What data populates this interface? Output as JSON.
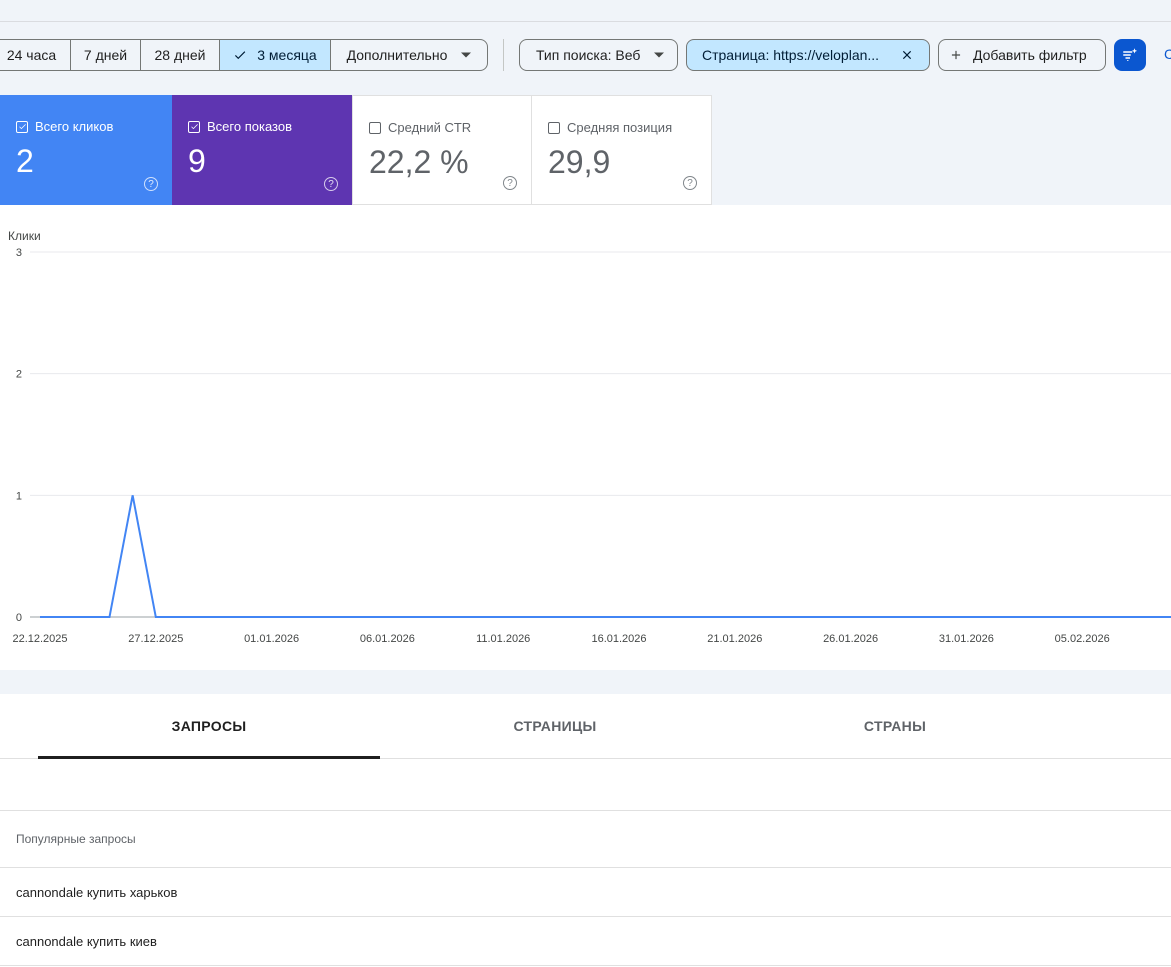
{
  "date_filters": [
    "24 часа",
    "7 дней",
    "28 дней",
    "3 месяца",
    "Дополнительно"
  ],
  "active_date_filter": "3 месяца",
  "search_type_label": "Тип поиска: Веб",
  "page_filter_label": "Страница: https://veloplan...",
  "add_filter_label": "Добавить фильтр",
  "metrics": {
    "clicks": {
      "label": "Всего кликов",
      "value": "2",
      "checked": true
    },
    "impressions": {
      "label": "Всего показов",
      "value": "9",
      "checked": true
    },
    "ctr": {
      "label": "Средний CTR",
      "value": "22,2 %",
      "checked": false
    },
    "position": {
      "label": "Средняя позиция",
      "value": "29,9",
      "checked": false
    }
  },
  "colors": {
    "clicks": "#4285f4",
    "impressions": "#5e35b1",
    "accent": "#0b57d0",
    "selected_chip": "#c2e7ff"
  },
  "chart_data": {
    "type": "line",
    "ylabel": "Клики",
    "ylim": [
      0,
      3
    ],
    "yticks": [
      "0",
      "1",
      "2",
      "3"
    ],
    "xticks": [
      "22.12.2025",
      "27.12.2025",
      "01.01.2026",
      "06.01.2026",
      "11.01.2026",
      "16.01.2026",
      "21.01.2026",
      "26.01.2026",
      "31.01.2026",
      "05.02.2026"
    ],
    "grid": true,
    "series": [
      {
        "color": "#4285f4",
        "points": [
          {
            "x": "22.12.2025",
            "y": 0
          },
          {
            "x": "25.12.2025",
            "y": 0
          },
          {
            "x": "26.12.2025",
            "y": 1
          },
          {
            "x": "27.12.2025",
            "y": 0
          },
          {
            "x": "10.02.2026",
            "y": 0
          }
        ]
      }
    ]
  },
  "tabs": [
    "ЗАПРОСЫ",
    "СТРАНИЦЫ",
    "СТРАНЫ"
  ],
  "active_tab": "ЗАПРОСЫ",
  "table": {
    "header": "Популярные запросы",
    "rows": [
      "cannondale купить харьков",
      "cannondale купить киев"
    ]
  }
}
